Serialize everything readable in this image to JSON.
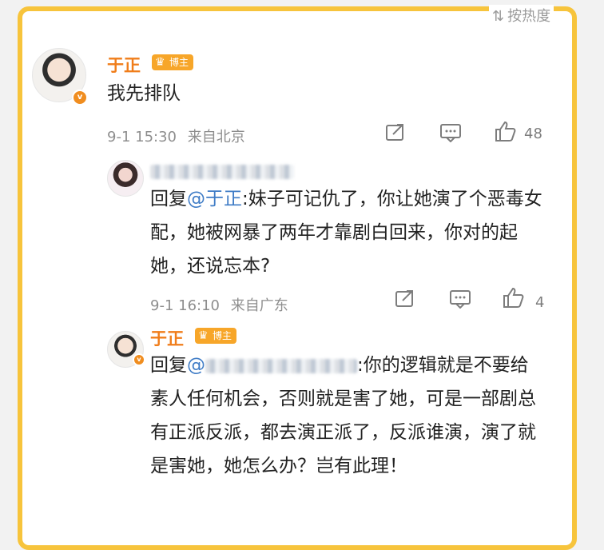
{
  "sort": {
    "label": "按热度",
    "icon": "swap-arrows-icon"
  },
  "comments": [
    {
      "author": "于正",
      "badge": "博主",
      "text": "我先排队",
      "time": "9-1 15:30",
      "location": "来自北京",
      "likes": "48"
    },
    {
      "author_redacted": true,
      "reply_prefix": "回复",
      "mention": "@于正",
      "text": ":妹子可记仇了，你让她演了个恶毒女配，她被网暴了两年才靠剧白回来，你对的起她，还说忘本?",
      "time": "9-1 16:10",
      "location": "来自广东",
      "likes": "4"
    },
    {
      "author": "于正",
      "badge": "博主",
      "reply_prefix": "回复",
      "mention_redacted": true,
      "text": ":你的逻辑就是不要给素人任何机会，否则就是害了她，可是一部剧总有正派反派，都去演正派了，反派谁演，演了就是害她，她怎么办？岂有此理！"
    }
  ],
  "colors": {
    "frame": "#f7c43c",
    "username": "#f07d1a",
    "mention": "#3f7cc6",
    "meta": "#8e8e8e"
  }
}
